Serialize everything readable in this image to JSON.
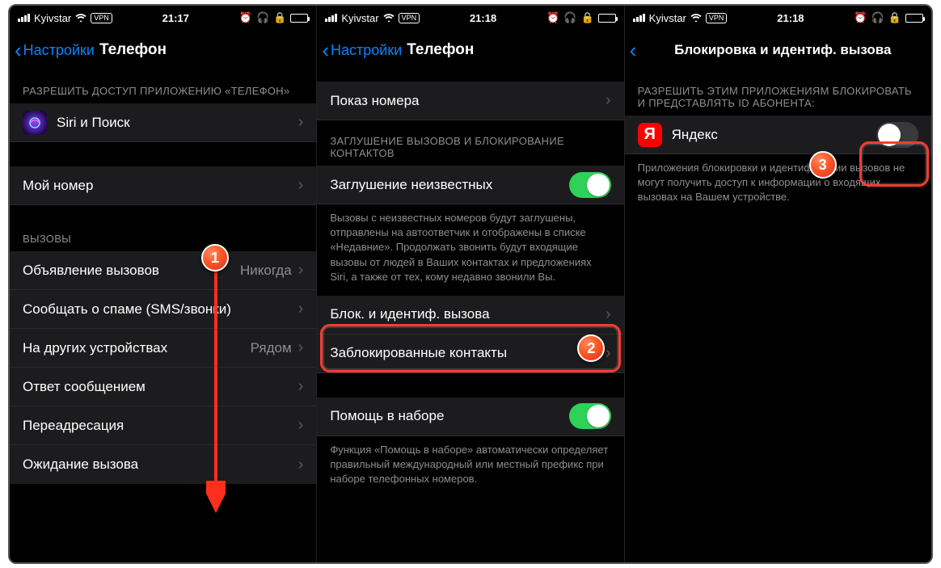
{
  "screens": [
    {
      "status": {
        "carrier": "Kyivstar",
        "vpn": "VPN",
        "time": "21:17"
      },
      "nav": {
        "back": "Настройки",
        "title": "Телефон"
      },
      "section_allow_header": "РАЗРЕШИТЬ ДОСТУП ПРИЛОЖЕНИЮ «ТЕЛЕФОН»",
      "siri": "Siri и Поиск",
      "my_number": "Мой номер",
      "calls_header": "ВЫЗОВЫ",
      "announce": {
        "label": "Объявление вызовов",
        "detail": "Никогда"
      },
      "spam": "Сообщать о спаме (SMS/звонки)",
      "other_devices": {
        "label": "На других устройствах",
        "detail": "Рядом"
      },
      "reply_msg": "Ответ сообщением",
      "forwarding": "Переадресация",
      "call_waiting": "Ожидание вызова"
    },
    {
      "status": {
        "carrier": "Kyivstar",
        "vpn": "VPN",
        "time": "21:18"
      },
      "nav": {
        "back": "Настройки",
        "title": "Телефон"
      },
      "show_number": "Показ номера",
      "silence_header": "ЗАГЛУШЕНИЕ ВЫЗОВОВ И БЛОКИРОВАНИЕ КОНТАКТОВ",
      "silence_unknown": "Заглушение неизвестных",
      "silence_footer": "Вызовы с неизвестных номеров будут заглушены, отправлены на автоответчик и отображены в списке «Недавние». Продолжать звонить будут входящие вызовы от людей в Ваших контактах и предложениях Siri, а также от тех, кому недавно звонили Вы.",
      "block_id": "Блок. и идентиф. вызова",
      "blocked_contacts": "Заблокированные контакты",
      "dial_assist": "Помощь в наборе",
      "dial_assist_footer": "Функция «Помощь в наборе» автоматически определяет правильный международный или местный префикс при наборе телефонных номеров."
    },
    {
      "status": {
        "carrier": "Kyivstar",
        "vpn": "VPN",
        "time": "21:18"
      },
      "nav": {
        "title": "Блокировка и идентиф. вызова"
      },
      "allow_header": "РАЗРЕШИТЬ ЭТИМ ПРИЛОЖЕНИЯМ БЛОКИРОВАТЬ И ПРЕДСТАВЛЯТЬ ID АБОНЕНТА:",
      "yandex": "Яндекс",
      "footer": "Приложения блокировки и идентификации вызовов не могут получить доступ к информации о входящих вызовах на Вашем устройстве."
    }
  ],
  "badges": {
    "b1": "1",
    "b2": "2",
    "b3": "3"
  }
}
